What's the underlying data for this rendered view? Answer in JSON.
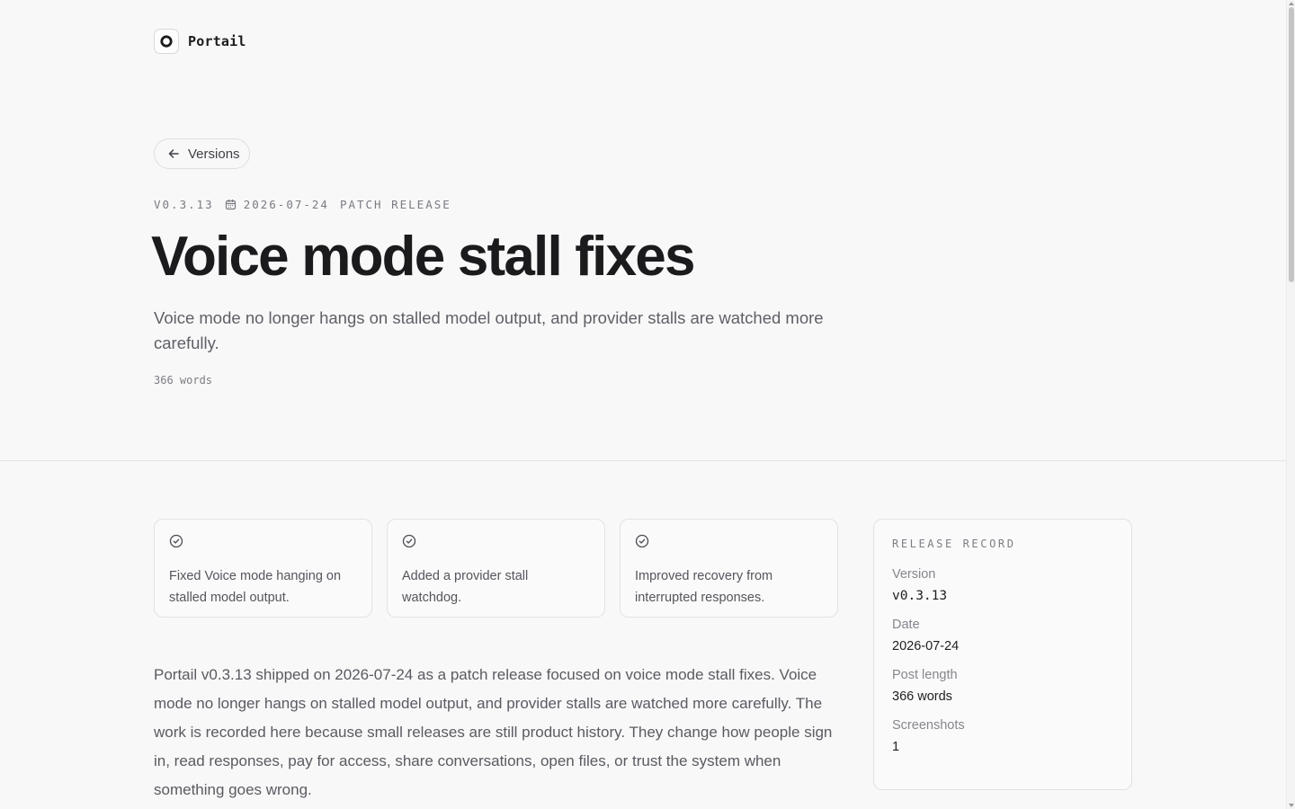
{
  "header": {
    "brand": "Portail",
    "logo_icon": "portail-logo-icon"
  },
  "back_button": {
    "label": "Versions",
    "icon": "arrow-left-icon"
  },
  "meta": {
    "version": "V0.3.13",
    "date": "2026-07-24",
    "release_type": "PATCH RELEASE",
    "date_icon": "calendar-icon"
  },
  "title": "Voice mode stall fixes",
  "subtitle": "Voice mode no longer hangs on stalled model output, and provider stalls are watched more carefully.",
  "word_count": "366 words",
  "highlights": [
    {
      "icon": "check-circle-icon",
      "text": "Fixed Voice mode hanging on stalled model output."
    },
    {
      "icon": "check-circle-icon",
      "text": "Added a provider stall watchdog."
    },
    {
      "icon": "check-circle-icon",
      "text": "Improved recovery from interrupted responses."
    }
  ],
  "body": "Portail v0.3.13 shipped on 2026-07-24 as a patch release focused on voice mode stall fixes. Voice mode no longer hangs on stalled model output, and provider stalls are watched more carefully. The work is recorded here because small releases are still product history. They change how people sign in, read responses, pay for access, share conversations, open files, or trust the system when something goes wrong.",
  "release_record": {
    "title": "RELEASE RECORD",
    "rows": [
      {
        "label": "Version",
        "value": "v0.3.13"
      },
      {
        "label": "Date",
        "value": "2026-07-24"
      },
      {
        "label": "Post length",
        "value": "366 words"
      },
      {
        "label": "Screenshots",
        "value": "1"
      }
    ]
  },
  "colors": {
    "background": "#f8f8f8",
    "text": "#18181b",
    "muted": "#5f5f67",
    "border": "#e2e2e6"
  }
}
